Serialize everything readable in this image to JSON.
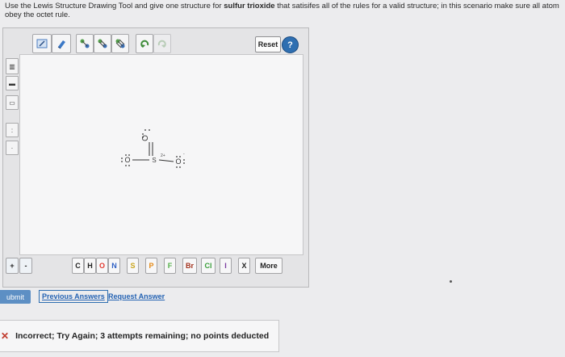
{
  "instructions": {
    "line1_pre": "Use the Lewis Structure Drawing Tool and give one structure for ",
    "line1_bold": "sulfur trioxide",
    "line1_post": " that satisifes all of the rules for a valid structure; in this scenario make sure all atom",
    "line2": "obey the octet rule."
  },
  "toolbar": {
    "tools": [
      "lightning-icon",
      "eraser-icon",
      "bond-single-icon",
      "bond-double-icon",
      "bond-triple-icon",
      "undo-icon",
      "redo-icon"
    ],
    "reset_label": "Reset",
    "help_label": "?"
  },
  "left_tools": [
    "ring-tool",
    "minus-tool",
    "bond-tool",
    "lone-pair-tool",
    "radical-tool"
  ],
  "molecule": {
    "center": "S",
    "center_charge": "2+",
    "top_o": "O",
    "left_o": "O",
    "right_o": "O",
    "right_o_charge": "-"
  },
  "charge_buttons": [
    "+",
    "-"
  ],
  "elements": [
    "C",
    "H",
    "O",
    "N",
    "S",
    "P",
    "F",
    "Br",
    "Cl",
    "I",
    "X"
  ],
  "more_label": "More",
  "submit_label": "ubmit",
  "previous_answers_label": "Previous Answers",
  "request_answer_label": "Request Answer",
  "feedback": {
    "message": "Incorrect; Try Again; 3 attempts remaining; no points deducted"
  },
  "colors": {
    "O": "#e2392f",
    "N": "#2d5fc4",
    "S": "#caa51c",
    "P": "#e58a17",
    "F": "#55b04a",
    "Cl": "#3a9f3a",
    "Br": "#a3331e",
    "I": "#7b3aa0",
    "link": "#2563b3"
  }
}
